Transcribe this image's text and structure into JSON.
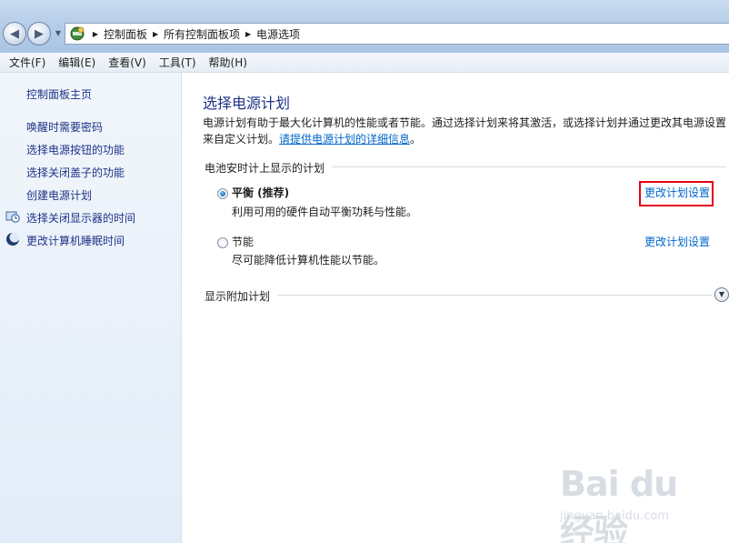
{
  "addressbar": {
    "breadcrumbs": [
      "控制面板",
      "所有控制面板项",
      "电源选项"
    ]
  },
  "menubar": {
    "items": [
      "文件(F)",
      "编辑(E)",
      "查看(V)",
      "工具(T)",
      "帮助(H)"
    ]
  },
  "sidebar": {
    "home": "控制面板主页",
    "links": [
      "唤醒时需要密码",
      "选择电源按钮的功能",
      "选择关闭盖子的功能",
      "创建电源计划"
    ],
    "icon_links": [
      "选择关闭显示器的时间",
      "更改计算机睡眠时间"
    ]
  },
  "main": {
    "title": "选择电源计划",
    "description": "电源计划有助于最大化计算机的性能或者节能。通过选择计划来将其激活，或选择计划并通过更改其电源设置来自定义计划。",
    "description_link": "请提供电源计划的详细信息",
    "group_label": "电池安时计上显示的计划",
    "plans": [
      {
        "name": "平衡 (推荐)",
        "desc": "利用可用的硬件自动平衡功耗与性能。",
        "link": "更改计划设置",
        "selected": true
      },
      {
        "name": "节能",
        "desc": "尽可能降低计算机性能以节能。",
        "link": "更改计划设置",
        "selected": false
      }
    ],
    "additional_plans": "显示附加计划"
  },
  "watermark": {
    "logo": "Bai du 经验",
    "url": "jingyan.baidu.com"
  },
  "colors": {
    "link": "#0066cc",
    "nav_text": "#1e3287",
    "highlight": "#e60012"
  }
}
